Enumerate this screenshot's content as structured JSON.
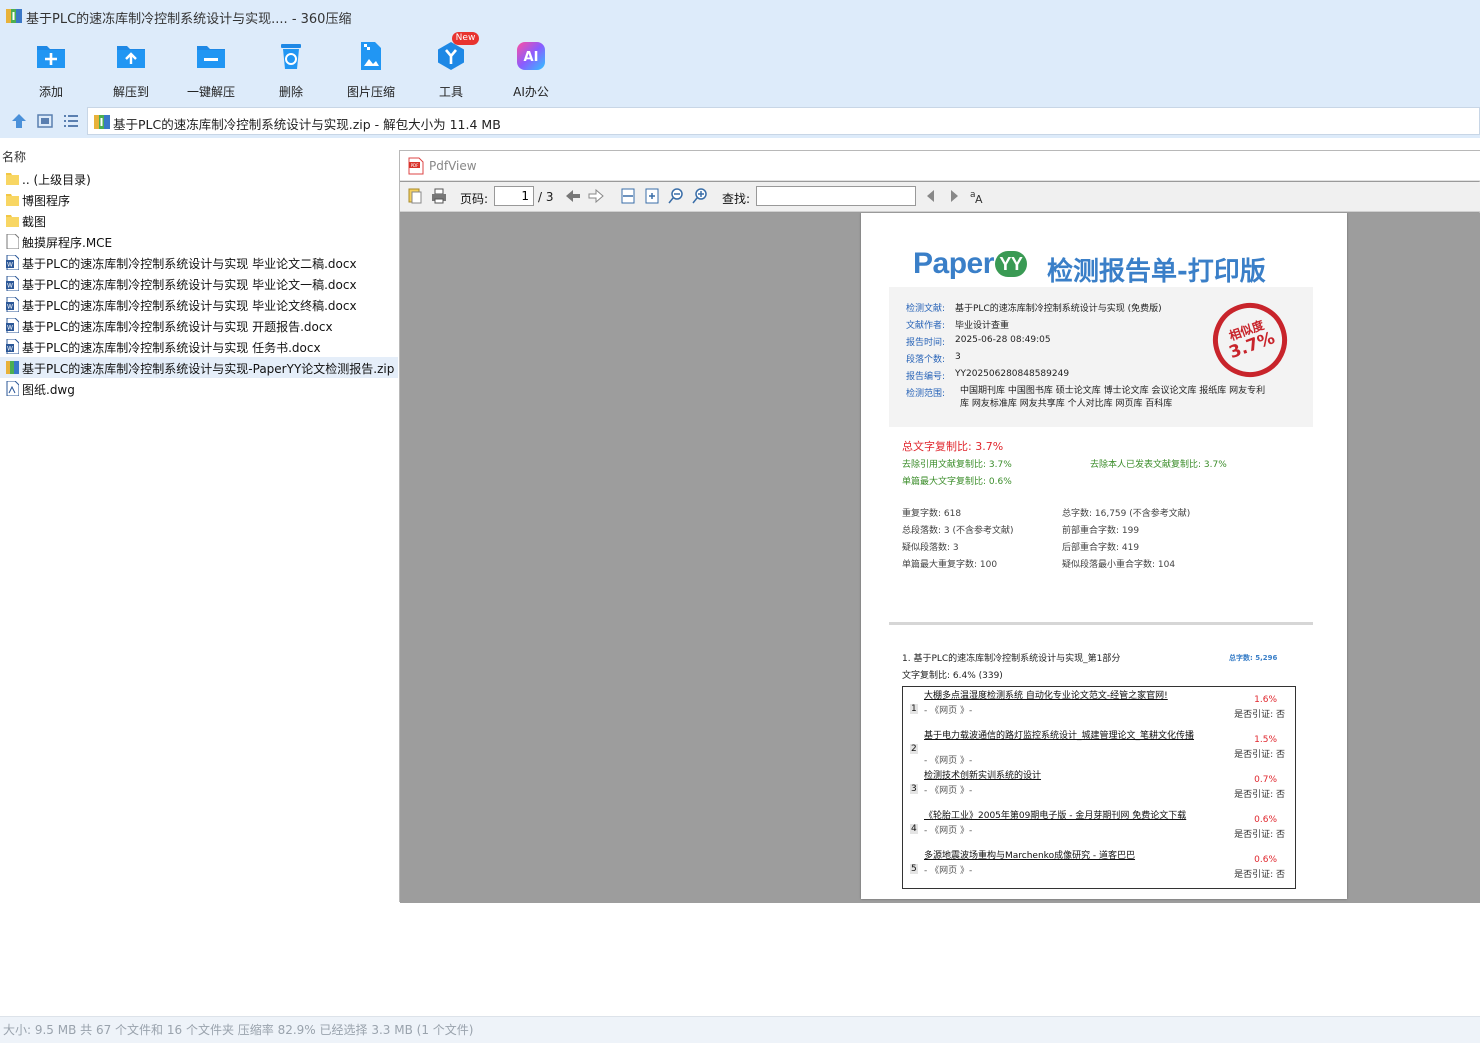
{
  "window": {
    "title": "基于PLC的速冻库制冷控制系统设计与实现.... - 360压缩"
  },
  "toolbar": {
    "buttons": [
      {
        "label": "添加",
        "icon": "add-icon"
      },
      {
        "label": "解压到",
        "icon": "extract-to-icon"
      },
      {
        "label": "一键解压",
        "icon": "one-click-extract-icon"
      },
      {
        "label": "删除",
        "icon": "delete-icon"
      },
      {
        "label": "图片压缩",
        "icon": "image-compress-icon"
      },
      {
        "label": "工具",
        "icon": "tools-icon"
      },
      {
        "label": "AI办公",
        "icon": "ai-office-icon"
      }
    ],
    "new_badge": "New"
  },
  "address": {
    "path": "基于PLC的速冻库制冷控制系统设计与实现.zip - 解包大小为 11.4 MB"
  },
  "filelist": {
    "column_header": "名称",
    "items": [
      {
        "name": ".. (上级目录)",
        "type": "folder"
      },
      {
        "name": "博图程序",
        "type": "folder"
      },
      {
        "name": "截图",
        "type": "folder"
      },
      {
        "name": "触摸屏程序.MCE",
        "type": "file"
      },
      {
        "name": "基于PLC的速冻库制冷控制系统设计与实现 毕业论文二稿.docx",
        "type": "docx"
      },
      {
        "name": "基于PLC的速冻库制冷控制系统设计与实现 毕业论文一稿.docx",
        "type": "docx"
      },
      {
        "name": "基于PLC的速冻库制冷控制系统设计与实现 毕业论文终稿.docx",
        "type": "docx"
      },
      {
        "name": "基于PLC的速冻库制冷控制系统设计与实现 开题报告.docx",
        "type": "docx"
      },
      {
        "name": "基于PLC的速冻库制冷控制系统设计与实现 任务书.docx",
        "type": "docx"
      },
      {
        "name": "基于PLC的速冻库制冷控制系统设计与实现-PaperYY论文检测报告.zip",
        "type": "zip",
        "selected": true
      },
      {
        "name": "图纸.dwg",
        "type": "dwg"
      }
    ]
  },
  "pdfview": {
    "title": "PdfView",
    "page_label": "页码:",
    "current_page": "1",
    "total_pages": "/ 3",
    "find_label": "查找:"
  },
  "report": {
    "logo": "Paper",
    "logo_mark": "YY",
    "heading": "检测报告单-打印版",
    "info": [
      {
        "key": "检测文献:",
        "value": "基于PLC的速冻库制冷控制系统设计与实现 (免费版)"
      },
      {
        "key": "文献作者:",
        "value": "毕业设计查重"
      },
      {
        "key": "报告时间:",
        "value": "2025-06-28 08:49:05"
      },
      {
        "key": "段落个数:",
        "value": "3"
      },
      {
        "key": "报告编号:",
        "value": "YY202506280848589249"
      }
    ],
    "range_key": "检测范围:",
    "range_values": "中国期刊库  中国图书库  硕士论文库  博士论文库  会议论文库  报纸库  网友专利库  网友标准库  网友共享库  个人对比库  网页库  百科库",
    "stamp": {
      "label": "相似度",
      "value": "3.7%"
    },
    "total_ratio": "总文字复制比: 3.7%",
    "exclude_ref": "去除引用文献复制比: 3.7%",
    "exclude_self": "去除本人已发表文献复制比: 3.7%",
    "max_single": "单篇最大文字复制比: 0.6%",
    "stats": [
      [
        "重复字数: 618",
        "总字数: 16,759 (不含参考文献)"
      ],
      [
        "总段落数: 3 (不含参考文献)",
        "前部重合字数: 199"
      ],
      [
        "疑似段落数: 3",
        "后部重合字数: 419"
      ],
      [
        "单篇最大重复字数: 100",
        "疑似段落最小重合字数: 104"
      ]
    ],
    "section_title": "1. 基于PLC的速冻库制冷控制系统设计与实现_第1部分",
    "section_total": "总字数: 5,296",
    "section_ratio": "文字复制比: 6.4% (339)",
    "sources": [
      {
        "num": "1",
        "title": "大棚多点温湿度检测系统 自动化专业论文范文-经管之家官网!",
        "sub": "- 《网页 》-",
        "pct": "1.6%",
        "cite": "是否引证: 否"
      },
      {
        "num": "2",
        "title": "基于电力载波通信的路灯监控系统设计_城建管理论文_笔耕文化传播",
        "sub": "- 《网页 》-",
        "pct": "1.5%",
        "cite": "是否引证: 否"
      },
      {
        "num": "3",
        "title": "检测技术创新实训系统的设计",
        "sub": "- 《网页 》-",
        "pct": "0.7%",
        "cite": "是否引证: 否"
      },
      {
        "num": "4",
        "title": "《轮胎工业》2005年第09期电子版 - 金月芽期刊网 免费论文下载",
        "sub": "- 《网页 》-",
        "pct": "0.6%",
        "cite": "是否引证: 否"
      },
      {
        "num": "5",
        "title": "多源地震波场重构与Marchenko成像研究 - 道客巴巴",
        "sub": "- 《网页 》-",
        "pct": "0.6%",
        "cite": "是否引证: 否"
      }
    ]
  },
  "statusbar": {
    "text": "大小: 9.5 MB 共 67 个文件和 16 个文件夹 压缩率 82.9% 已经选择 3.3 MB (1 个文件)"
  }
}
